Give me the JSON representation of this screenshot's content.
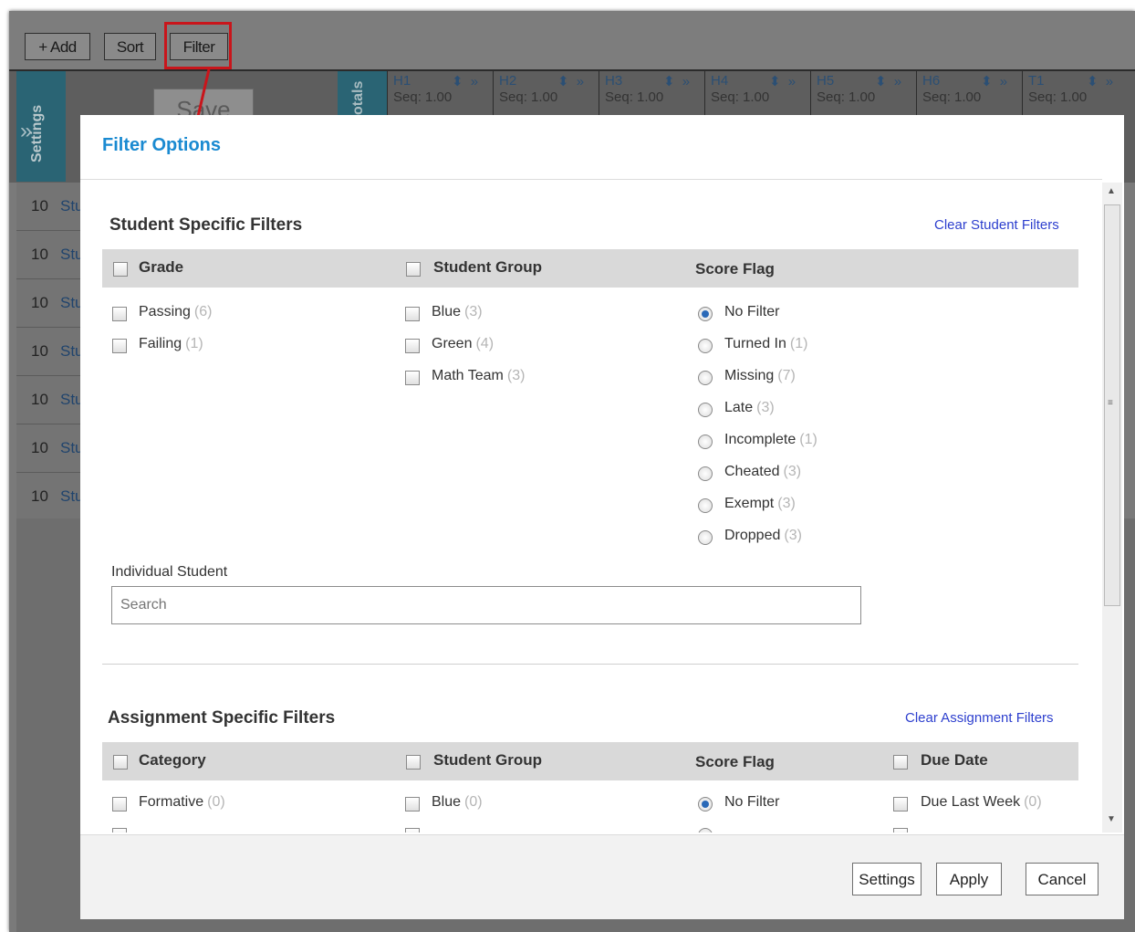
{
  "toolbar": {
    "add_label": "+ Add",
    "sort_label": "Sort",
    "filter_label": "Filter"
  },
  "grid": {
    "settings_label": "Settings",
    "save_label": "Save",
    "totals_label": "otals",
    "columns": [
      {
        "title": "H1",
        "seq": "Seq: 1.00"
      },
      {
        "title": "H2",
        "seq": "Seq: 1.00"
      },
      {
        "title": "H3",
        "seq": "Seq: 1.00"
      },
      {
        "title": "H4",
        "seq": "Seq: 1.00"
      },
      {
        "title": "H5",
        "seq": "Seq: 1.00"
      },
      {
        "title": "H6",
        "seq": "Seq: 1.00"
      },
      {
        "title": "T1",
        "seq": "Seq: 1.00"
      }
    ],
    "rows": [
      {
        "num": "10",
        "name": "Stu"
      },
      {
        "num": "10",
        "name": "Stu"
      },
      {
        "num": "10",
        "name": "Stu"
      },
      {
        "num": "10",
        "name": "Stu"
      },
      {
        "num": "10",
        "name": "Stu"
      },
      {
        "num": "10",
        "name": "Stu"
      },
      {
        "num": "10",
        "name": "Stu"
      }
    ]
  },
  "modal": {
    "title": "Filter Options",
    "student": {
      "title": "Student Specific Filters",
      "clear_label": "Clear Student Filters",
      "headers": {
        "grade": "Grade",
        "group": "Student Group",
        "flag": "Score Flag"
      },
      "grade_options": [
        {
          "label": "Passing",
          "count": "(6)"
        },
        {
          "label": "Failing",
          "count": "(1)"
        }
      ],
      "group_options": [
        {
          "label": "Blue",
          "count": "(3)"
        },
        {
          "label": "Green",
          "count": "(4)"
        },
        {
          "label": "Math Team",
          "count": "(3)"
        }
      ],
      "flag_options": [
        {
          "label": "No Filter",
          "count": "",
          "selected": true
        },
        {
          "label": "Turned In",
          "count": "(1)"
        },
        {
          "label": "Missing",
          "count": "(7)"
        },
        {
          "label": "Late",
          "count": "(3)"
        },
        {
          "label": "Incomplete",
          "count": "(1)"
        },
        {
          "label": "Cheated",
          "count": "(3)"
        },
        {
          "label": "Exempt",
          "count": "(3)"
        },
        {
          "label": "Dropped",
          "count": "(3)"
        }
      ],
      "individual_label": "Individual Student",
      "search_placeholder": "Search"
    },
    "assignment": {
      "title": "Assignment Specific Filters",
      "clear_label": "Clear Assignment Filters",
      "headers": {
        "category": "Category",
        "group": "Student Group",
        "flag": "Score Flag",
        "due": "Due Date"
      },
      "category_first": {
        "label": "Formative",
        "count": "(0)"
      },
      "group_first": {
        "label": "Blue",
        "count": "(0)"
      },
      "flag_first": {
        "label": "No Filter",
        "selected": true
      },
      "due_first": {
        "label": "Due Last Week",
        "count": "(0)"
      }
    },
    "buttons": {
      "settings": "Settings",
      "apply": "Apply",
      "cancel": "Cancel"
    }
  }
}
